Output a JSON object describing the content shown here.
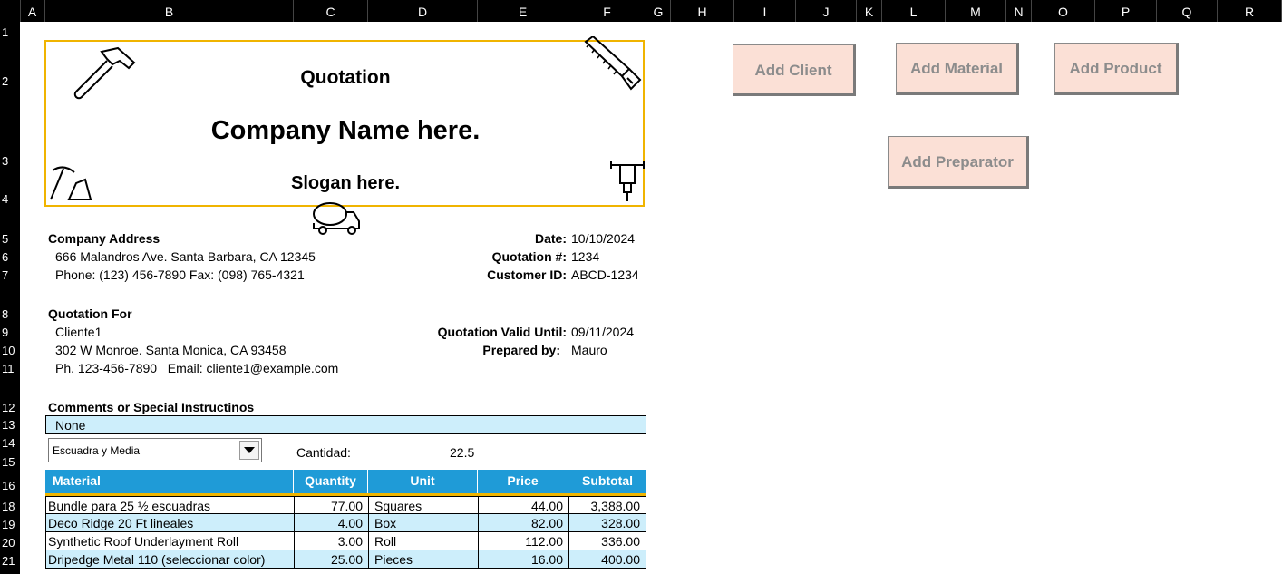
{
  "columns": [
    "A",
    "B",
    "C",
    "D",
    "E",
    "F",
    "G",
    "H",
    "I",
    "J",
    "K",
    "L",
    "M",
    "N",
    "O",
    "P",
    "Q",
    "R"
  ],
  "rows": [
    "1",
    "2",
    "3",
    "4",
    "5",
    "6",
    "7",
    "8",
    "9",
    "10",
    "11",
    "12",
    "13",
    "14",
    "15",
    "16",
    "18",
    "19",
    "20",
    "21"
  ],
  "banner": {
    "title": "Quotation",
    "company": "Company Name here.",
    "slogan": "Slogan here."
  },
  "buttons": {
    "add_client": "Add Client",
    "add_material": "Add Material",
    "add_product": "Add Product",
    "add_preparator": "Add Preparator"
  },
  "company": {
    "heading": "Company Address",
    "address": "666 Malandros Ave. Santa Barbara, CA 12345",
    "phone": "Phone: (123) 456-7890 Fax: (098) 765-4321"
  },
  "meta": {
    "date_label": "Date:",
    "date_value": "10/10/2024",
    "quote_label": "Quotation #:",
    "quote_value": "1234",
    "customer_label": "Customer ID:",
    "customer_value": "ABCD-1234",
    "valid_label": "Quotation Valid Until:",
    "valid_value": "09/11/2024",
    "prepared_label": "Prepared by:",
    "prepared_value": "Mauro"
  },
  "client": {
    "heading": "Quotation For",
    "name": "Cliente1",
    "address": "302 W Monroe. Santa Monica, CA 93458",
    "contact": "Ph. 123-456-7890   Email: cliente1@example.com"
  },
  "comments": {
    "heading": "Comments or Special Instructinos",
    "value": "None"
  },
  "selector": {
    "selected": "Escuadra y Media",
    "qty_label": "Cantidad:",
    "qty_value": "22.5"
  },
  "table": {
    "headers": [
      "Material",
      "Quantity",
      "Unit",
      "Price",
      "Subtotal"
    ],
    "rows": [
      [
        "Bundle para 25 ½ escuadras",
        "77.00",
        "Squares",
        "44.00",
        "3,388.00"
      ],
      [
        "Deco Ridge 20 Ft lineales",
        "4.00",
        "Box",
        "82.00",
        "328.00"
      ],
      [
        "Synthetic Roof Underlayment Roll",
        "3.00",
        "Roll",
        "112.00",
        "336.00"
      ],
      [
        "Dripedge Metal 110 (seleccionar color)",
        "25.00",
        "Pieces",
        "16.00",
        "400.00"
      ]
    ]
  },
  "colors": {
    "header_blue": "#1f9bd7",
    "accent_gold": "#f0b400",
    "band_light_blue": "#cdeefb",
    "button_peach": "#fbe0d6"
  },
  "icons": [
    "hammer-icon",
    "saw-icon",
    "pickaxe-icon",
    "jackhammer-icon",
    "cement-truck-icon",
    "dropdown-arrow-icon"
  ]
}
